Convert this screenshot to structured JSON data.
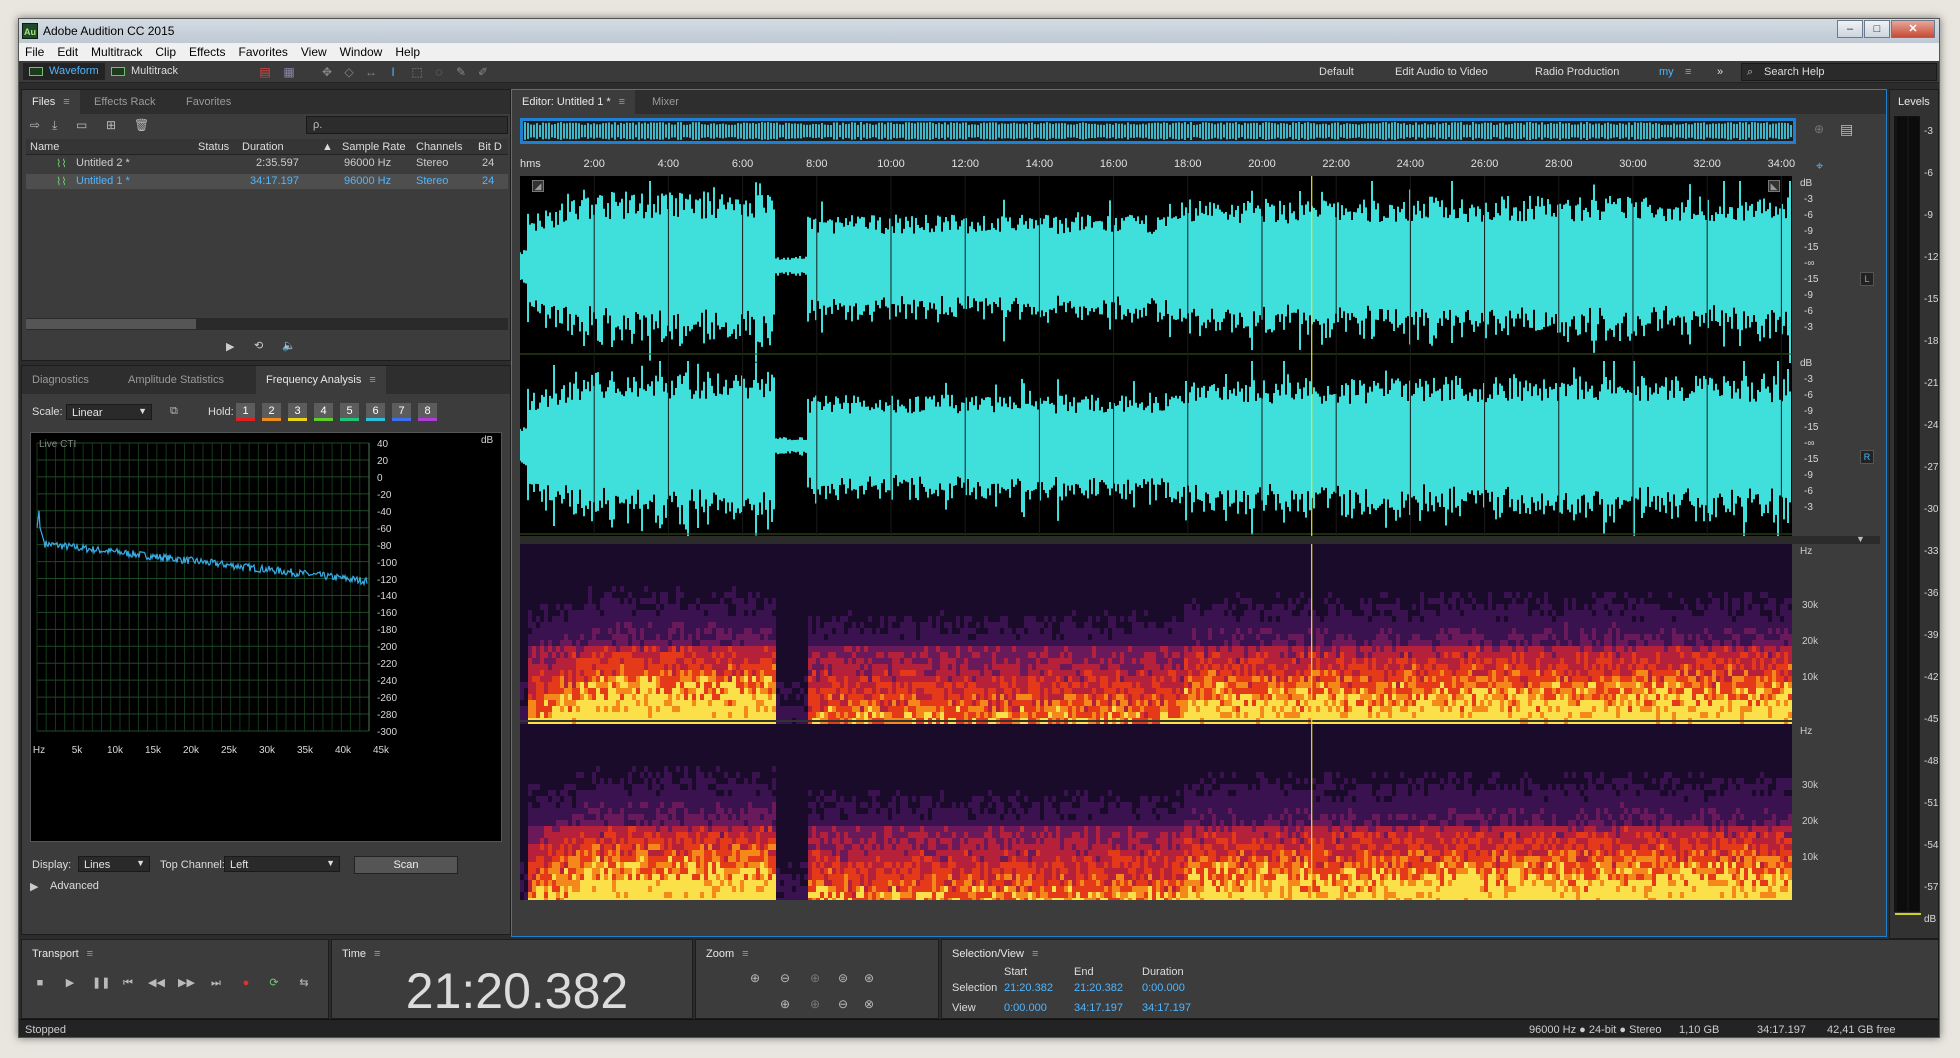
{
  "window": {
    "title": "Adobe Audition CC 2015",
    "app_icon": "Au"
  },
  "menu": [
    "File",
    "Edit",
    "Multitrack",
    "Clip",
    "Effects",
    "Favorites",
    "View",
    "Window",
    "Help"
  ],
  "toolbar": {
    "waveform_label": "Waveform",
    "multitrack_label": "Multitrack",
    "workspaces": [
      "Default",
      "Edit Audio to Video",
      "Radio Production",
      "my"
    ],
    "search_placeholder": "Search Help"
  },
  "files_panel": {
    "tabs": [
      "Files",
      "Effects Rack",
      "Favorites"
    ],
    "search_glyph": "ρ.",
    "columns": [
      "Name",
      "Status",
      "Duration",
      "Sample Rate",
      "Channels",
      "Bit D"
    ],
    "rows": [
      {
        "name": "Untitled 2 *",
        "status": "",
        "duration": "2:35.597",
        "sample_rate": "96000 Hz",
        "channels": "Stereo",
        "bit_depth": "24"
      },
      {
        "name": "Untitled 1 *",
        "status": "",
        "duration": "34:17.197",
        "sample_rate": "96000 Hz",
        "channels": "Stereo",
        "bit_depth": "24"
      }
    ]
  },
  "analysis_panel": {
    "tabs": [
      "Diagnostics",
      "Amplitude Statistics",
      "Frequency Analysis"
    ],
    "scale_label": "Scale:",
    "scale_value": "Linear",
    "hold_label": "Hold:",
    "hold_buttons": [
      "1",
      "2",
      "3",
      "4",
      "5",
      "6",
      "7",
      "8"
    ],
    "hold_colors": [
      "#e02020",
      "#f08a1a",
      "#e8d21a",
      "#5ccf2c",
      "#1fc37a",
      "#2ac0e0",
      "#3d6ff0",
      "#b13bd8"
    ],
    "live_cti": "Live CTI",
    "y_unit": "dB",
    "y_labels": [
      "40",
      "20",
      "0",
      "-20",
      "-40",
      "-60",
      "-80",
      "-100",
      "-120",
      "-140",
      "-160",
      "-180",
      "-200",
      "-220",
      "-240",
      "-260",
      "-280",
      "-300"
    ],
    "x_labels": [
      "Hz",
      "5k",
      "10k",
      "15k",
      "20k",
      "25k",
      "30k",
      "35k",
      "40k",
      "45k"
    ],
    "display_label": "Display:",
    "display_value": "Lines",
    "top_channel_label": "Top Channel:",
    "top_channel_value": "Left",
    "scan_label": "Scan",
    "advanced_label": "Advanced"
  },
  "editor": {
    "tab_label": "Editor: Untitled 1 *",
    "mixer_label": "Mixer",
    "timeline_unit": "hms",
    "timeline_labels": [
      "2:00",
      "4:00",
      "6:00",
      "8:00",
      "10:00",
      "12:00",
      "14:00",
      "16:00",
      "18:00",
      "20:00",
      "22:00",
      "24:00",
      "26:00",
      "28:00",
      "30:00",
      "32:00",
      "34:00"
    ],
    "db_unit": "dB",
    "db_labels": [
      "-3",
      "-6",
      "-9",
      "-15",
      "-∞",
      "-15",
      "-9",
      "-6",
      "-3"
    ],
    "channel_left": "L",
    "channel_right": "R",
    "hz_unit": "Hz",
    "spec_labels": [
      "30k",
      "20k",
      "10k"
    ],
    "waveform_color": "#3fe0dc",
    "playhead_color": "#e8e81a"
  },
  "levels": {
    "title": "Levels",
    "scale": [
      "-3",
      "-6",
      "-9",
      "-12",
      "-15",
      "-18",
      "-21",
      "-24",
      "-27",
      "-30",
      "-33",
      "-36",
      "-39",
      "-42",
      "-45",
      "-48",
      "-51",
      "-54",
      "-57"
    ],
    "unit": "dB"
  },
  "transport": {
    "title": "Transport"
  },
  "time": {
    "title": "Time",
    "value": "21:20.382"
  },
  "zoom": {
    "title": "Zoom"
  },
  "selection": {
    "title": "Selection/View",
    "headers": [
      "Start",
      "End",
      "Duration"
    ],
    "selection_label": "Selection",
    "view_label": "View",
    "selection_values": [
      "21:20.382",
      "21:20.382",
      "0:00.000"
    ],
    "view_values": [
      "0:00.000",
      "34:17.197",
      "34:17.197"
    ]
  },
  "status": {
    "state": "Stopped",
    "format": "96000 Hz ● 24-bit ● Stereo",
    "size": "1,10 GB",
    "duration": "34:17.197",
    "free": "42,41 GB free"
  }
}
